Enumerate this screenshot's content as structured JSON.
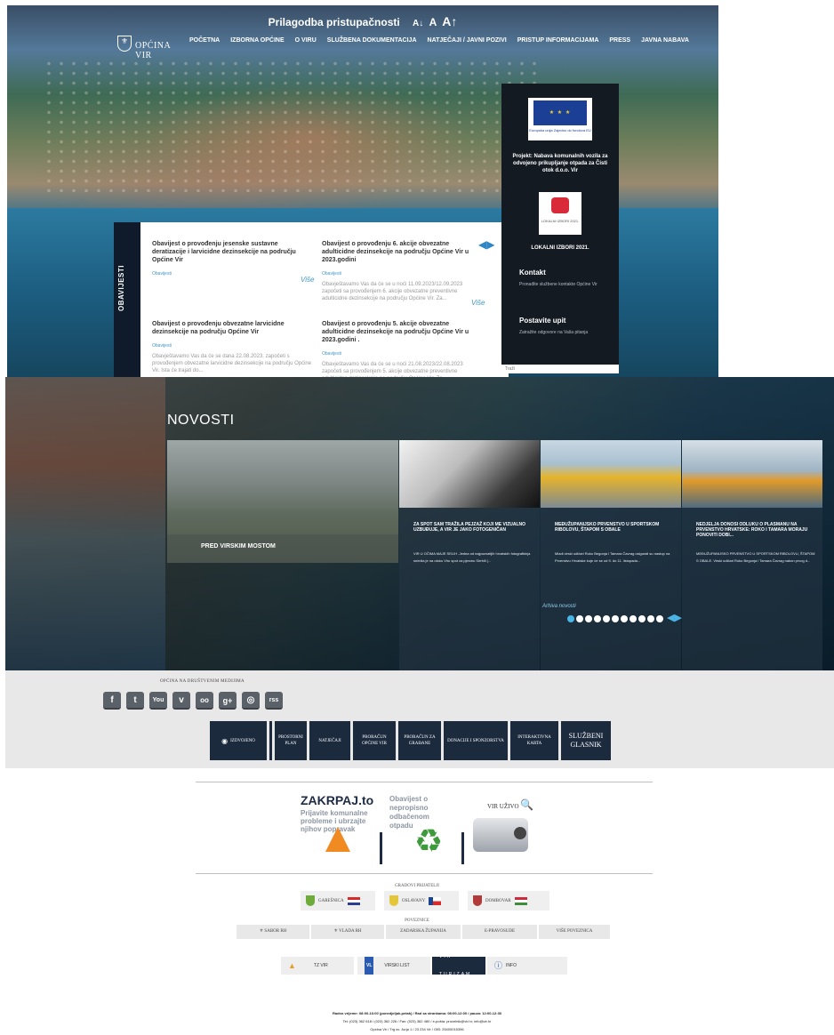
{
  "accessibility": {
    "title": "Prilagodba pristupačnosti",
    "sizes": [
      "A↓",
      "A",
      "A↑"
    ]
  },
  "logo": {
    "name": "OPĆINA VIR"
  },
  "nav": [
    "POČETNA",
    "IZBORNA OPĆINE",
    "O VIRU",
    "SLUŽBENA DOKUMENTACIJA",
    "NATJEČAJI / JAVNI POZIVI",
    "PRISTUP INFORMACIJAMA",
    "PRESS",
    "JAVNA NABAVA"
  ],
  "notices": {
    "label": "OBAVIJESTI",
    "more": "Više",
    "items": [
      {
        "title": "Obavijest o provođenju jesenske sustavne deratizacije i larvicidne dezinsekcije na području Općine Vir",
        "category": "Obavijesti",
        "text": ""
      },
      {
        "title": "Obavijest o provođenju 6. akcije obvezatne adulticidne dezinsekcije na području Općine Vir u 2023.godini",
        "category": "Obavijesti",
        "text": "Obavještavamo Vas da će se u noći 11.09.2023/12.09.2023 započeti sa provođenjem 6. akcije obvezatne preventivne adulticidne dezinsekcije na području Općine Vir. Za..."
      },
      {
        "title": "Obavijest o provođenju obvezatne larvicidne dezinsekcije na području Općine Vir",
        "category": "Obavijesti",
        "text": "Obavještavamo Vas da će se dana 22.08.2023. započeti s provođenjem obvezatne larvicidne dezinsekcije na području Općine Vir. Ista će trajati do..."
      },
      {
        "title": "Obavijest o provođenju 5. akcije obvezatne adulticidne dezinsekcije na području Općine Vir u 2023.godini .",
        "category": "Obavijesti",
        "text": "Obavještavamo Vas da će se u noći 21.08.2023/22.08.2023 započeti sa provođenjem 5. akcije obvezatne preventivne adulticidne dezinsekcije na području Općine Vir. Za..."
      }
    ]
  },
  "right_panel": {
    "eu_caption": "Europska unija Zajedno do fondova EU",
    "project": "Projekt: Nabava komunalnih vozila za odvojeno prikupljanje otpada za Čisti otok d.o.o. Vir",
    "izbori_img": "LOKALNI IZBORI 2021.",
    "izbori_caption": "LOKALNI IZBORI 2021.",
    "kontakt_title": "Kontakt",
    "kontakt_sub": "Pronađite službene kontakte Općine Vir",
    "upit_title": "Postavite upit",
    "upit_sub": "Zatražite odgovore na Vaša pitanja",
    "search_placeholder": "Traži"
  },
  "novosti": {
    "title": "NOVOSTI",
    "featured": "PRED VIRSKIM MOSTOM",
    "cards": [
      {
        "title": "ZA SPOT SAM TRAŽILA PEJZAŽ KOJI ME VIZUALNO UZBUĐUJE, A VIR JE JAKO FOTOGENIČAN",
        "text": "VIR U OČIMA MAJE SELIH -Jedna od najpoznatijih hrvatskih fotografkinja snimila je na otoku Viru spot za pjesmu Sirrbili (..."
      },
      {
        "title": "MEĐUŽUPANIJSKO PRVENSTVO U SPORTSKOM RIBOLOVU, ŠTAPOM S OBALE",
        "text": "Mladi virski udičari Roko Begonja i Tamara Čavrag osigurali su nastup na Prvenstvu Hrvatske koje će se od 9. do 11. listopada..."
      },
      {
        "title": "NEDJELJA DONOSI ODLUKU O PLASMANU NA PRVENSTVO HRVATSKE: ROKO I TAMARA MORAJU PONOVITI DOBI...",
        "text": "MEĐUŽUPANIJSKO PRVENSTVO U SPORTSKOM RIBOLOVU, ŠTAPOM S OBALE. Virski udičari Roko Begonja i Tamara Čavrag nakon prvog d..."
      }
    ],
    "archive": "Arhiva novosti"
  },
  "social": {
    "label": "OPĆINA NA DRUŠTVENIM MEDIJIMA",
    "icons": [
      "f",
      "t",
      "You",
      "v",
      "oo",
      "g+",
      "◎",
      "rss"
    ]
  },
  "tiles": [
    "IZDVOJENO",
    "PROSTORNI PLAN",
    "NATJEČAJI",
    "PRORAČUN OPĆINE VIR",
    "PRORAČUN ZA GRAĐANE",
    "DONACIJE I SPONZORSTVA",
    "INTERAKTIVNA KARTA",
    "SLUŽBENI GLASNIK"
  ],
  "banners": {
    "zk_logo": "ZAKRPAJ.to",
    "zk_text": "Prijavite komunalne probleme i ubrzajte njihov popravak",
    "otpad": "Obavijest o nepropisno odbačenom otpadu",
    "vir_uzivo": "VIR UŽIVO",
    "zoom_icon": "🔍"
  },
  "partners": {
    "title": "GRADOVI PRIJATELJI",
    "items": [
      "GAREŠNICA",
      "OSLAVANY",
      "DOMBOVAR"
    ]
  },
  "links": {
    "title": "POVEZNICE",
    "items": [
      "SABOR RH",
      "VLADA RH",
      "ZADARSKA ŽUPANIJA",
      "E-PRAVOSUDE",
      "VIŠE POVEZNICA"
    ]
  },
  "bottom": [
    "TZ VIR",
    "VIRSKI LIST",
    "VIR TURIZAM",
    "INFO"
  ],
  "footer": [
    "Radno vrijeme: 08:00-16:00 (ponedjeljak-petak) / Rad sa strankama: 08:00-12:00 / pauza: 12:00-12:30",
    "Tel: (023) 362 618 / (023) 362 226 / Fax: (023) 362 480 / e-pošta: procelnik@vir.hr; info@vir.hr",
    "Općina Vir / Trg sv. Jurja 1 / 23 234 Vir / OIB: 25400015396"
  ],
  "colors": {
    "accent": "#3f97c9",
    "dark_navy": "#1c2a3e",
    "panel": "#141a22"
  }
}
